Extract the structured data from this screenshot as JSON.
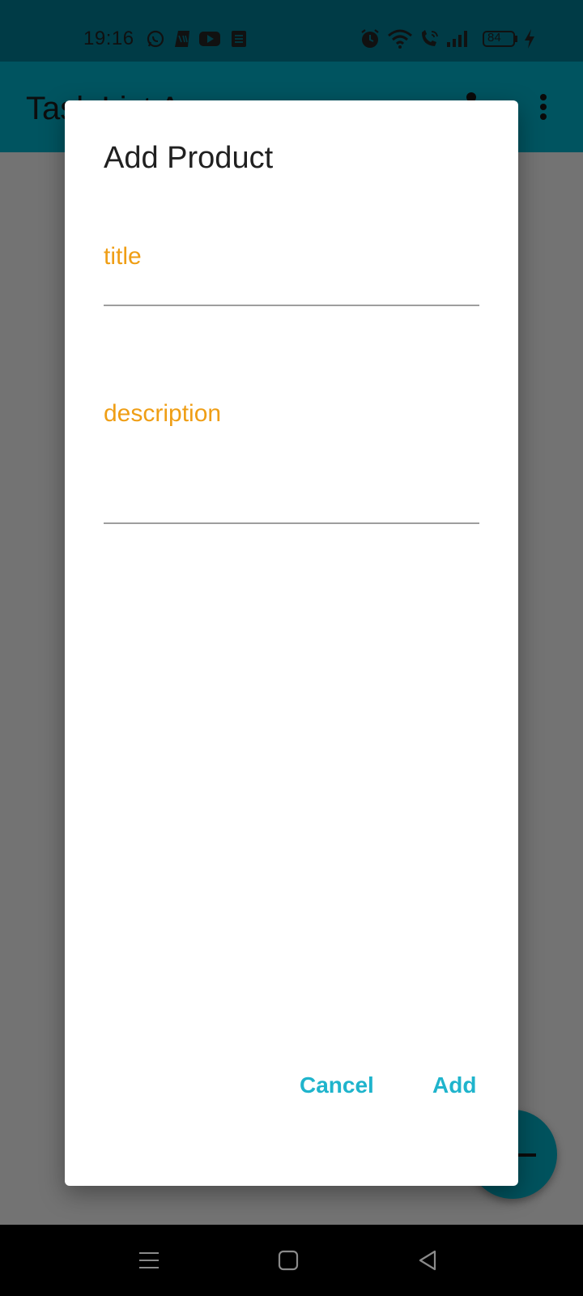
{
  "status_bar": {
    "time": "19:16",
    "battery": "84",
    "icons": [
      "whatsapp-icon",
      "myjio-icon",
      "youtube-icon",
      "notes-icon",
      "alarm-icon",
      "wifi-icon",
      "wifi-call-icon",
      "signal-icon",
      "battery-icon",
      "charging-icon"
    ]
  },
  "app_bar": {
    "title": "Task List App",
    "actions": [
      "share-icon",
      "overflow-menu-icon"
    ]
  },
  "dialog": {
    "title": "Add Product",
    "fields": [
      {
        "label": "title",
        "value": ""
      },
      {
        "label": "description",
        "value": ""
      }
    ],
    "buttons": {
      "cancel": "Cancel",
      "add": "Add"
    }
  },
  "fab": {
    "icon": "plus-icon"
  },
  "nav_bar": {
    "icons": [
      "menu-icon",
      "home-icon",
      "back-icon"
    ]
  },
  "colors": {
    "status_bar": "#003b46",
    "app_bar": "#005460",
    "accent_label": "#ef9e15",
    "dialog_button": "#1fb4cc",
    "scrim": "#737373"
  }
}
